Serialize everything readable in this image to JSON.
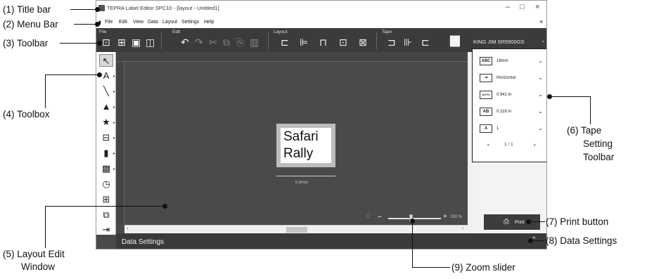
{
  "callouts": {
    "title_bar": "(1) Title bar",
    "menu_bar": "(2) Menu Bar",
    "toolbar": "(3) Toolbar",
    "toolbox": "(4) Toolbox",
    "layout_edit_1": "(5) Layout Edit",
    "layout_edit_2": "Window",
    "tape_setting_1": "(6) Tape",
    "tape_setting_2": "Setting",
    "tape_setting_3": "Toolbar",
    "print_button": "(7) Print button",
    "data_settings": "(8) Data Settings",
    "zoom_slider": "(9) Zoom slider"
  },
  "window": {
    "title": "TEPRA Label Editor SPC10 - [layout - Untitled1]",
    "minimize": "–",
    "maximize": "□",
    "close": "×",
    "menu_close": "×"
  },
  "menu": [
    "File",
    "Edit",
    "View",
    "Data",
    "Layout",
    "Settings",
    "Help"
  ],
  "toolbar": {
    "groups": [
      "File",
      "Edit",
      "Layout",
      "Tape"
    ],
    "printer": "KING JIM SR5900GS",
    "printer_chevron": "⌄"
  },
  "tape_panel": {
    "width_label": "ABC",
    "width": "18mm",
    "direction": "Horizontal",
    "length_label": "AUTO",
    "length": "0.941 in",
    "margin_label": "AB",
    "margin": "0.118 in",
    "copies_label": "A",
    "copies": "1",
    "page": "1 / 1",
    "prev": "◂",
    "next": "▸"
  },
  "canvas": {
    "label_line1": "Safari",
    "label_line2": "Rally",
    "dimension": "0.941in"
  },
  "zoom": {
    "minus": "–",
    "plus": "+",
    "value": "150 %",
    "fit": "⛶",
    "percent": 50
  },
  "print_label": "Print",
  "data_settings_label": "Data Settings",
  "data_settings_chevron": "⌃"
}
